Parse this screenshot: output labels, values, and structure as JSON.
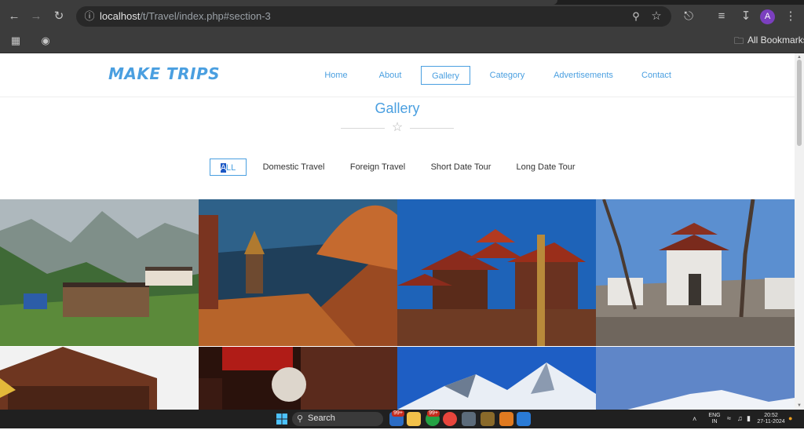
{
  "browser": {
    "url_host": "localhost",
    "url_path": "/t/Travel/index.php#section-3",
    "bookmarks_label": "All Bookmarks",
    "profile_initial": "A",
    "icons": [
      "back-arrow-icon",
      "forward-arrow-icon",
      "reload-icon",
      "info-icon",
      "zoom-icon",
      "star-icon",
      "extensions-icon",
      "reading-list-icon",
      "download-icon",
      "menu-dots-icon",
      "apps-grid-icon",
      "globe-icon",
      "folder-icon"
    ]
  },
  "site": {
    "logo": "MAKE TRIPS",
    "nav": [
      "Home",
      "About",
      "Gallery",
      "Category",
      "Advertisements",
      "Contact"
    ],
    "active_nav": "Gallery",
    "section_title": "Gallery",
    "filters": [
      {
        "label_hl": "A",
        "label_rest": "LL"
      },
      {
        "label": "Domestic Travel"
      },
      {
        "label": "Foreign Travel"
      },
      {
        "label": "Short Date Tour"
      },
      {
        "label": "Long Date Tour"
      }
    ],
    "accent_color": "#4a9fe0"
  },
  "taskbar": {
    "search_label": "Search",
    "badge_1": "99+",
    "badge_2": "99+",
    "lang_1": "ENG",
    "lang_2": "IN",
    "time": "20:52",
    "date": "27-11-2024"
  }
}
